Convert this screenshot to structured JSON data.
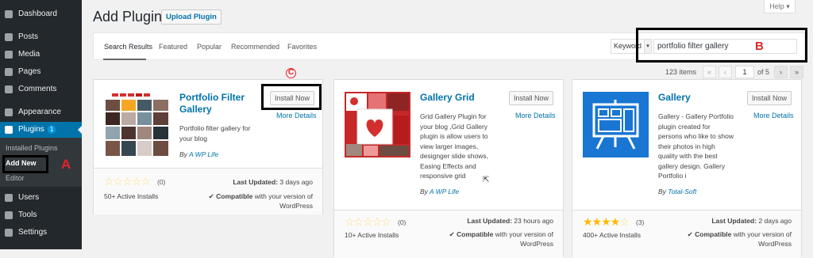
{
  "sidebar": {
    "items": [
      {
        "label": "Dashboard",
        "icon": "dashboard-icon"
      },
      {
        "label": "Posts",
        "icon": "pin-icon"
      },
      {
        "label": "Media",
        "icon": "media-icon"
      },
      {
        "label": "Pages",
        "icon": "page-icon"
      },
      {
        "label": "Comments",
        "icon": "comment-icon"
      },
      {
        "label": "Appearance",
        "icon": "brush-icon"
      },
      {
        "label": "Plugins",
        "icon": "plug-icon",
        "badge": "1"
      },
      {
        "label": "Users",
        "icon": "users-icon"
      },
      {
        "label": "Tools",
        "icon": "wrench-icon"
      },
      {
        "label": "Settings",
        "icon": "settings-icon"
      }
    ],
    "submenu": [
      "Installed Plugins",
      "Add New",
      "Editor"
    ]
  },
  "header": {
    "title": "Add Plugins",
    "upload_label": "Upload Plugin",
    "help_label": "Help ▾"
  },
  "tabs": [
    "Search Results",
    "Featured",
    "Popular",
    "Recommended",
    "Favorites"
  ],
  "search": {
    "type_label": "Keyword",
    "value": "portfolio filter gallery"
  },
  "pagination": {
    "count": "123 items",
    "first": "«",
    "prev": "‹",
    "current": "1",
    "of": "of 5",
    "next": "›",
    "last": "»"
  },
  "plugins": [
    {
      "title": "Portfolio Filter Gallery",
      "install": "Install Now",
      "more": "More Details",
      "desc": "Portfolio filter gallery for your blog",
      "by_prefix": "By",
      "author": "A WP Life",
      "rating": 0,
      "rating_count": "(0)",
      "installs": "50+ Active Installs",
      "updated_label": "Last Updated:",
      "updated_value": "3 days ago",
      "compat_bold": "Compatible",
      "compat_rest": "with your version of WordPress"
    },
    {
      "title": "Gallery Grid",
      "install": "Install Now",
      "more": "More Details",
      "desc": "Grid Gallery Plugin for your blog ,Grid Gallery plugin is allow users to view larger images, designger slide shows, Easing Effects and responsive grid",
      "by_prefix": "By",
      "author": "A WP Life",
      "rating": 0,
      "rating_count": "(0)",
      "installs": "10+ Active Installs",
      "updated_label": "Last Updated:",
      "updated_value": "23 hours ago",
      "compat_bold": "Compatible",
      "compat_rest": "with your version of WordPress"
    },
    {
      "title": "Gallery",
      "install": "Install Now",
      "more": "More Details",
      "desc": "Gallery - Gallery Portfolio plugin created for persons who like to show their photos in high quality with the best gallery design. Gallery Portfolio i",
      "by_prefix": "By",
      "author": "Total-Soft",
      "rating": 4,
      "rating_count": "(3)",
      "installs": "400+ Active Installs",
      "updated_label": "Last Updated:",
      "updated_value": "2 days ago",
      "compat_bold": "Compatible",
      "compat_rest": "with your version of WordPress"
    }
  ],
  "annotations": {
    "a": "A",
    "b": "B",
    "c": "C"
  },
  "colors": {
    "sidebar": "#23282d",
    "accent": "#0073aa",
    "star": "#ffb900",
    "annotation": "#e0252b"
  }
}
